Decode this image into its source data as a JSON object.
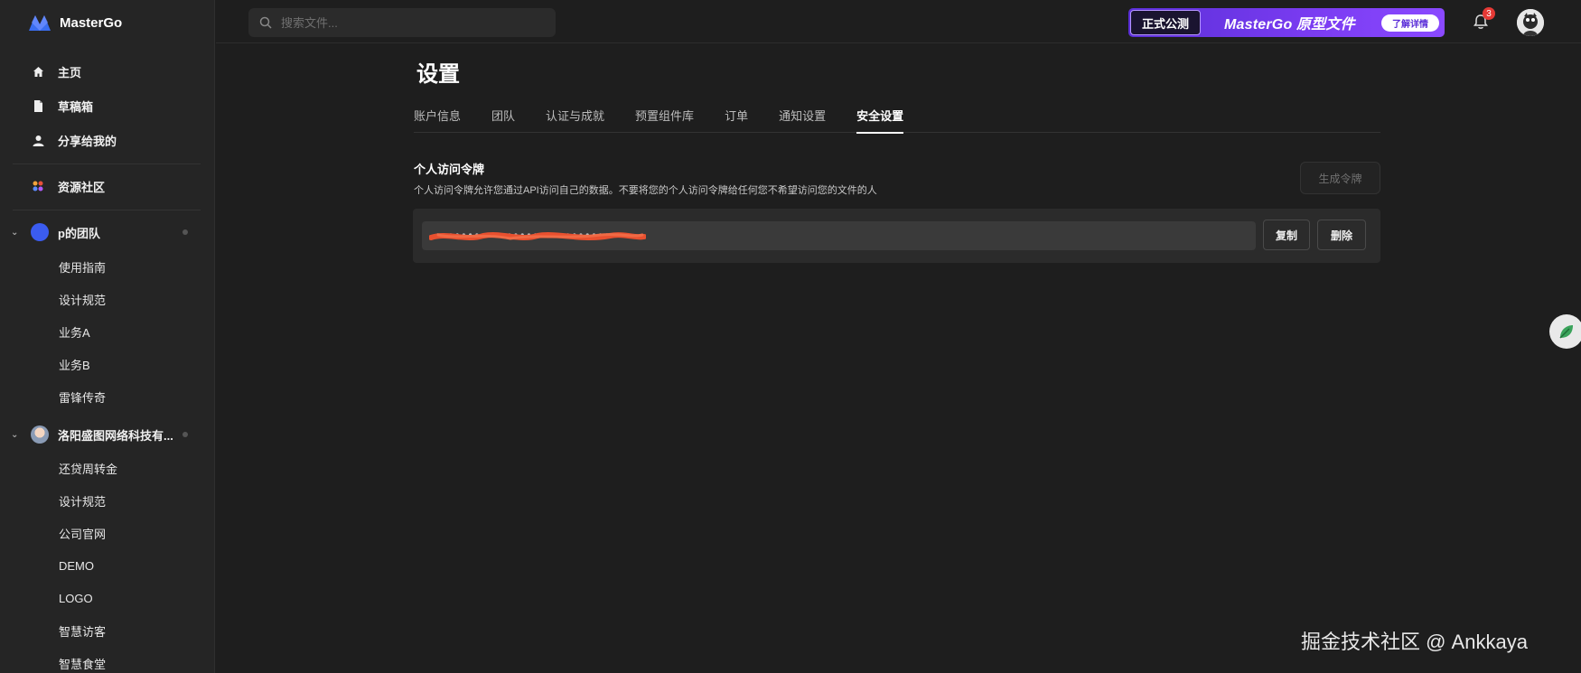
{
  "app": {
    "name": "MasterGo"
  },
  "sidebar": {
    "nav": [
      {
        "label": "主页",
        "icon": "home-icon"
      },
      {
        "label": "草稿箱",
        "icon": "file-icon"
      },
      {
        "label": "分享给我的",
        "icon": "user-icon"
      }
    ],
    "community": {
      "label": "资源社区",
      "icon": "grid-colorful-icon"
    },
    "teams": [
      {
        "name": "p的团队",
        "projects": [
          "使用指南",
          "设计规范",
          "业务A",
          "业务B",
          "雷锋传奇"
        ]
      },
      {
        "name": "洛阳盛图网络科技有...",
        "projects": [
          "还贷周转金",
          "设计规范",
          "公司官网",
          "DEMO",
          "LOGO",
          "智慧访客",
          "智慧食堂"
        ]
      }
    ]
  },
  "topbar": {
    "search_placeholder": "搜索文件...",
    "promo": {
      "tag": "正式公测",
      "title": "MasterGo 原型文件",
      "button": "了解详情"
    },
    "notifications_count": "3"
  },
  "main": {
    "title": "设置",
    "tabs": [
      "账户信息",
      "团队",
      "认证与成就",
      "预置组件库",
      "订单",
      "通知设置",
      "安全设置"
    ],
    "active_tab": "安全设置",
    "token_section": {
      "title": "个人访问令牌",
      "description": "个人访问令牌允许您通过API访问自己的数据。不要将您的个人访问令牌给任何您不希望访问您的文件的人",
      "generate_button": "生成令牌",
      "token_value": "••••••••••••••••••••••••••••••",
      "copy_button": "复制",
      "delete_button": "删除"
    }
  },
  "watermark": {
    "text": "掘金技术社区 @ Ankkaya"
  },
  "colors": {
    "accent": "#7b3cf2",
    "badge": "#e53935",
    "redaction": "#e8502f"
  }
}
